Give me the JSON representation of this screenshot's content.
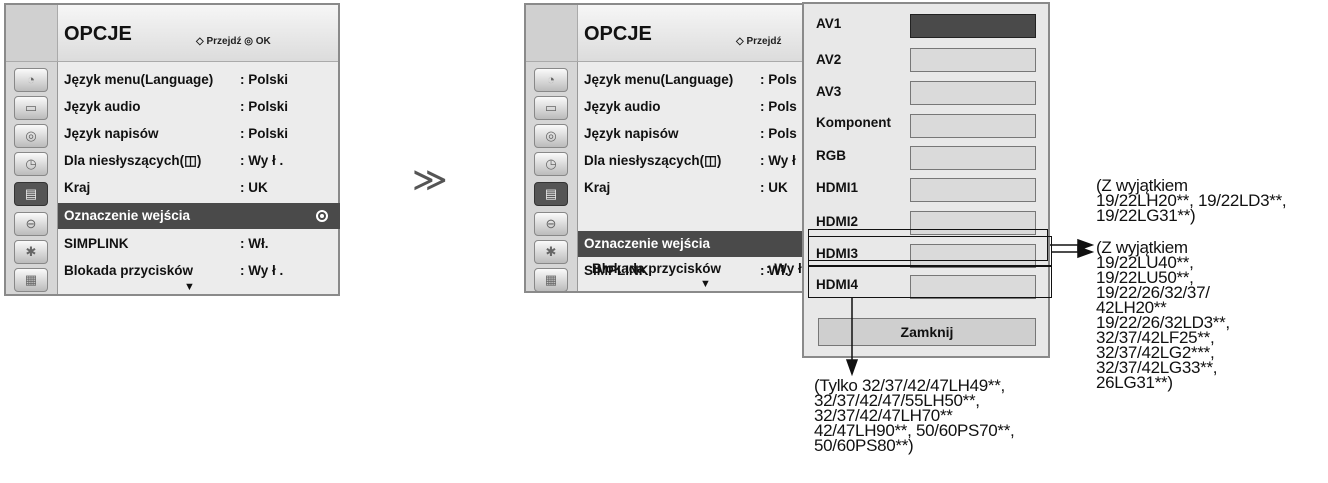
{
  "left_menu": {
    "title": "OPCJE",
    "nav_hint": "Przejdź ◎ OK",
    "rows": [
      {
        "label": "Język menu(Language)",
        "value": ": Polski"
      },
      {
        "label": "Język audio",
        "value": ": Polski"
      },
      {
        "label": "Język napisów",
        "value": ": Polski"
      },
      {
        "label": "Dla niesłyszących(◫)",
        "value": ": Wy ł ."
      },
      {
        "label": "Kraj",
        "value": ": UK"
      },
      {
        "label": "Oznaczenie wejścia",
        "value": ""
      },
      {
        "label": "SIMPLINK",
        "value": ": Wł."
      },
      {
        "label": "Blokada przycisków",
        "value": ": Wy ł ."
      }
    ]
  },
  "right_menu": {
    "title": "OPCJE",
    "nav_hint": "Przejdź",
    "rows": [
      {
        "label": "Język menu(Language)",
        "value": ": Pols"
      },
      {
        "label": "Język audio",
        "value": ": Pols"
      },
      {
        "label": "Język napisów",
        "value": ": Pols"
      },
      {
        "label": "Dla niesłyszących(◫)",
        "value": ": Wy ł"
      },
      {
        "label": "Kraj",
        "value": ": UK"
      },
      {
        "label": "Oznaczenie wejścia",
        "value": ""
      },
      {
        "label": "SIMPLINK",
        "value": ": Wł."
      },
      {
        "label": "Blokada przycisków",
        "value": ": Wy ł"
      }
    ]
  },
  "separator_symbol": "≫",
  "input_panel": {
    "inputs": [
      "AV1",
      "AV2",
      "AV3",
      "Komponent",
      "RGB",
      "HDMI1",
      "HDMI2",
      "HDMI3",
      "HDMI4"
    ],
    "close_label": "Zamknij"
  },
  "notes": {
    "hdmi2": "(Z wyjątkiem\n19/22LH20**, 19/22LD3**,\n19/22LG31**)",
    "hdmi3": "(Z wyjątkiem\n19/22LU40**,\n19/22LU50**,\n19/22/26/32/37/\n42LH20**\n19/22/26/32LD3**,\n32/37/42LF25**,\n32/37/42LG2***,\n32/37/42LG33**,\n26LG31**)",
    "hdmi4": "(Tylko 32/37/42/47LH49**,\n32/37/42/47/55LH50**,\n32/37/42/47LH70**\n42/47LH90**, 50/60PS70**,\n50/60PS80**)"
  }
}
